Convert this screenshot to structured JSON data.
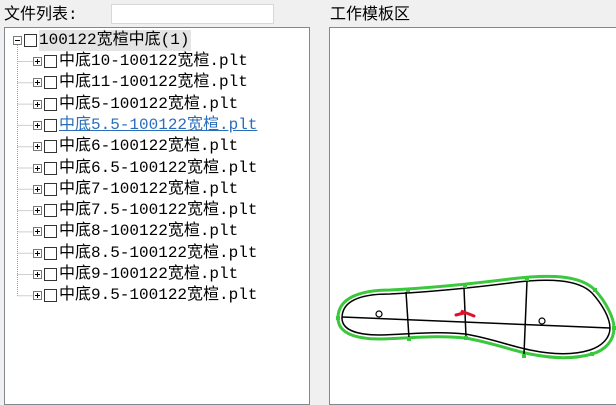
{
  "file_list": {
    "label": "文件列表:",
    "search_value": ""
  },
  "tree": {
    "root": "100122宽楦中底(1)",
    "children": [
      "中底10-100122宽楦.plt",
      "中底11-100122宽楦.plt",
      "中底5-100122宽楦.plt",
      "中底5.5-100122宽楦.plt",
      "中底6-100122宽楦.plt",
      "中底6.5-100122宽楦.plt",
      "中底7-100122宽楦.plt",
      "中底7.5-100122宽楦.plt",
      "中底8-100122宽楦.plt",
      "中底8.5-100122宽楦.plt",
      "中底9-100122宽楦.plt",
      "中底9.5-100122宽楦.plt"
    ],
    "hovered_index": 3
  },
  "template_area": {
    "label": "工作模板区"
  },
  "colors": {
    "outline_green": "#3cc83c",
    "link_blue": "#2a6ebb",
    "mark_red": "#e0102a"
  }
}
